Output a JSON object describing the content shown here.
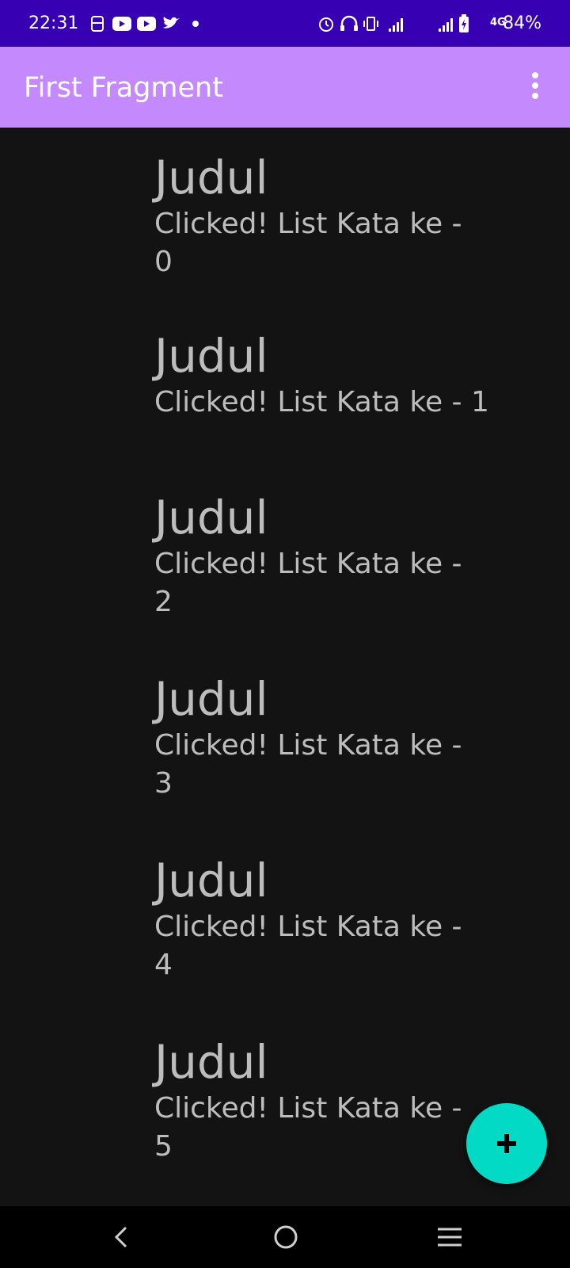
{
  "status_bar": {
    "time": "22:31",
    "network_label": "4G",
    "battery": "84%",
    "left_icons": [
      "bitmoji-icon",
      "youtube-icon",
      "youtube-icon",
      "twitter-icon",
      "dot-icon"
    ],
    "right_icons": [
      "alarm-icon",
      "headphones-icon",
      "vibrate-icon",
      "signal-icon",
      "signal-icon",
      "battery-charging-icon"
    ]
  },
  "app_bar": {
    "title": "First Fragment",
    "menu_icon": "more-vert-icon"
  },
  "list": {
    "items": [
      {
        "title": "Judul",
        "subtitle": "Clicked! List Kata ke -\n0"
      },
      {
        "title": "Judul",
        "subtitle": "Clicked! List Kata ke - 1"
      },
      {
        "title": "Judul",
        "subtitle": "Clicked! List Kata ke -\n2"
      },
      {
        "title": "Judul",
        "subtitle": "Clicked! List Kata ke -\n3"
      },
      {
        "title": "Judul",
        "subtitle": "Clicked! List Kata ke -\n4"
      },
      {
        "title": "Judul",
        "subtitle": "Clicked! List Kata ke -\n5"
      }
    ]
  },
  "fab": {
    "icon": "plus-icon",
    "color": "#03DAC5"
  },
  "nav_bar": {
    "icons": [
      "back-icon",
      "home-icon",
      "recents-icon"
    ]
  },
  "colors": {
    "status_bar": "#3700B3",
    "app_bar": "#C48AFD",
    "background": "#131313",
    "list_text": "#BDBDBD",
    "fab": "#03DAC5"
  }
}
